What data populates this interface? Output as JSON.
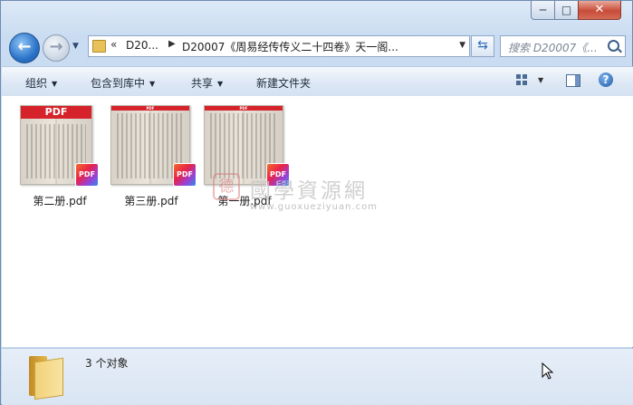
{
  "window": {
    "controls": {
      "minimize": "─",
      "maximize": "□",
      "close": "✕"
    }
  },
  "nav": {
    "back_glyph": "←",
    "forward_glyph": "→",
    "address": {
      "chevron": "«",
      "crumb1": "D20...",
      "separator": "▶",
      "crumb2": "D20007《周易经传传义二十四卷》天一阁..."
    },
    "refresh_glyph": "⇆",
    "search_placeholder": "搜索 D20007《..."
  },
  "toolbar": {
    "organize": "组织",
    "include_in_library": "包含到库中",
    "share": "共享",
    "new_folder": "新建文件夹",
    "help": "?"
  },
  "files": [
    {
      "name": "第二册.pdf",
      "thumb_header": "PDF",
      "badge": "PDF"
    },
    {
      "name": "第三册.pdf",
      "thumb_header": "PDF",
      "badge": "PDF"
    },
    {
      "name": "第一册.pdf",
      "thumb_header": "PDF",
      "badge": "PDF"
    }
  ],
  "watermark": {
    "seal": "德",
    "title": "國學資源網",
    "url": "www.guoxueziyuan.com"
  },
  "status": {
    "count": "3 个对象"
  }
}
